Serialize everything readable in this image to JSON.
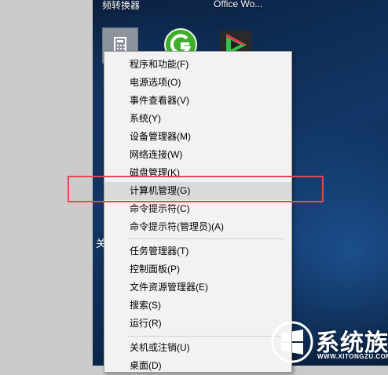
{
  "desktop": {
    "labels": [
      "频转换器",
      "Office Wo..."
    ],
    "side_char": "关"
  },
  "context_menu": {
    "items": [
      {
        "label": "程序和功能(F)"
      },
      {
        "label": "电源选项(O)"
      },
      {
        "label": "事件查看器(V)"
      },
      {
        "label": "系统(Y)"
      },
      {
        "label": "设备管理器(M)"
      },
      {
        "label": "网络连接(W)"
      },
      {
        "label": "磁盘管理(K)"
      },
      {
        "label": "计算机管理(G)",
        "state": "hover"
      },
      {
        "label": "命令提示符(C)"
      },
      {
        "label": "命令提示符(管理员)(A)"
      },
      {
        "label": "任务管理器(T)"
      },
      {
        "label": "控制面板(P)"
      },
      {
        "label": "文件资源管理器(E)"
      },
      {
        "label": "搜索(S)"
      },
      {
        "label": "运行(R)"
      },
      {
        "label": "关机或注销(U)"
      },
      {
        "label": "桌面(D)"
      }
    ]
  },
  "annotation": {
    "color": "#e2494f"
  },
  "watermark": {
    "text": "系统族",
    "url": "WWW.XITONGZU.COM"
  },
  "icons": [
    "calculator-icon",
    "greenshot-icon",
    "video-app-icon",
    "windows-logo-icon"
  ]
}
